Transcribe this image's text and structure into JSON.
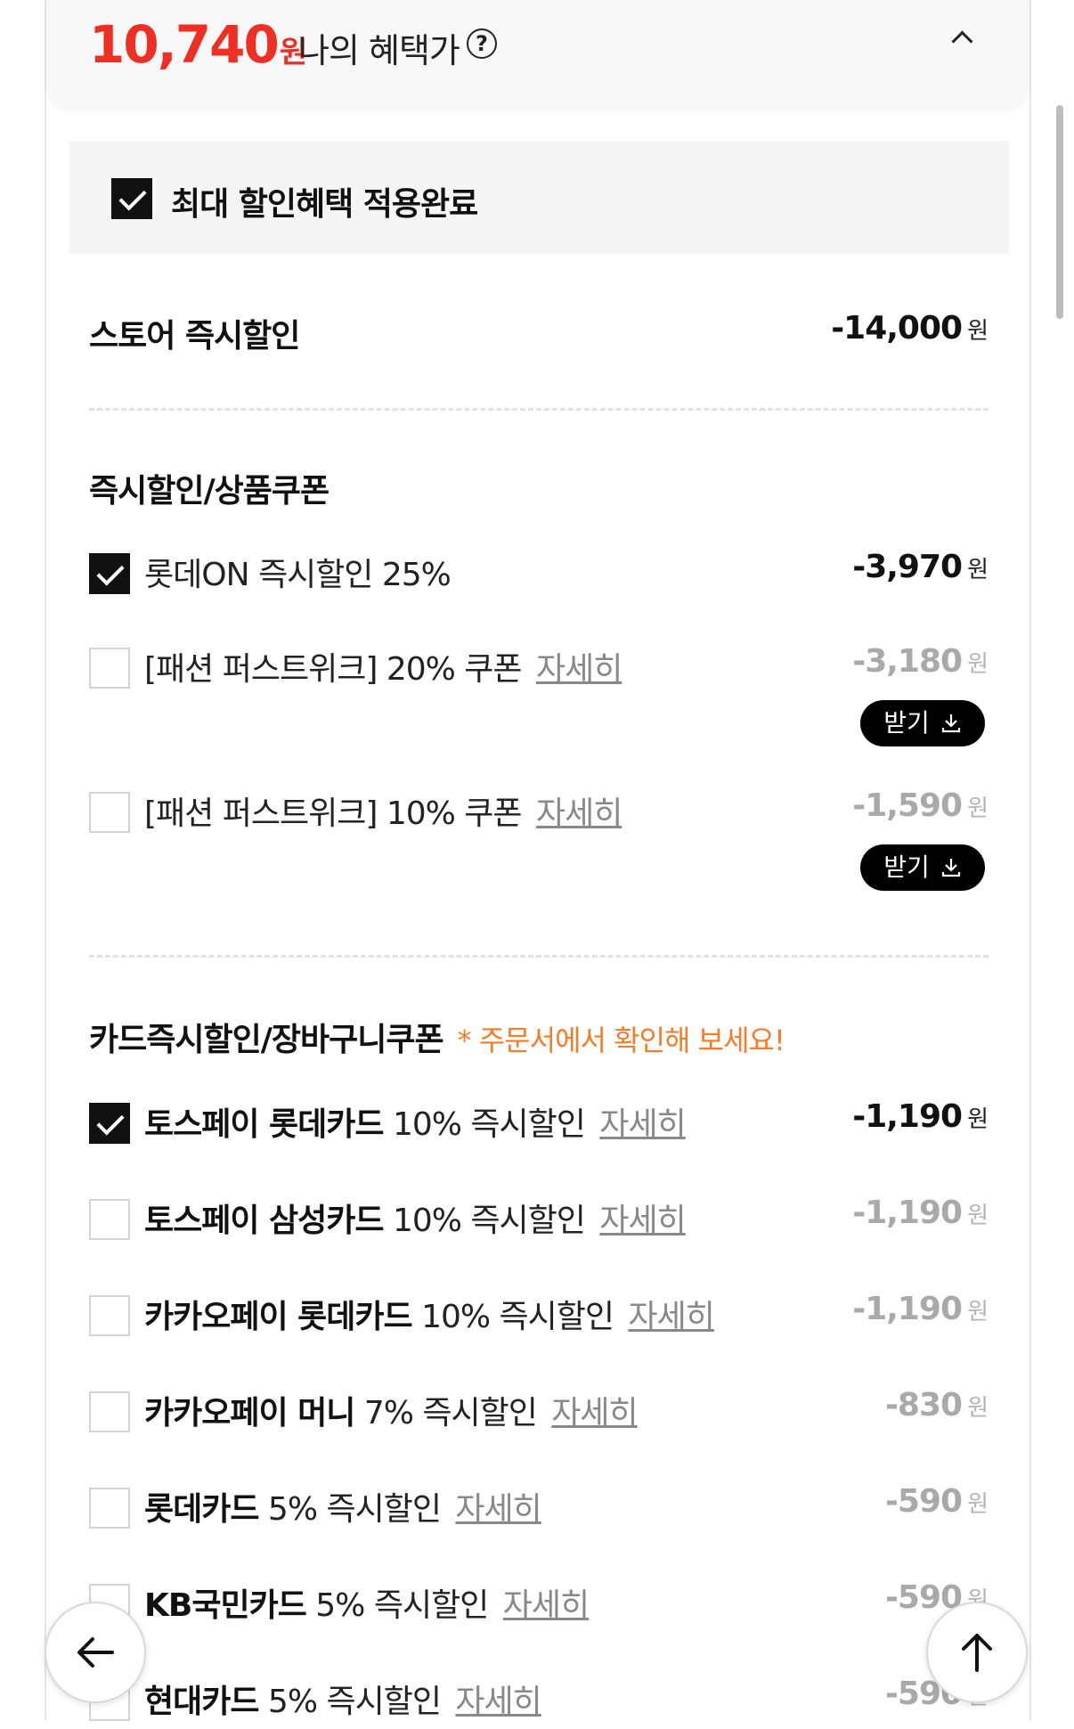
{
  "header": {
    "price": "10,740",
    "price_unit": "원",
    "benefit_label": "나의 혜택가",
    "help_icon_glyph": "?"
  },
  "applied": {
    "label": "최대 할인혜택 적용완료",
    "checked": true
  },
  "store_discount": {
    "label": "스토어 즉시할인",
    "amount": "-14,000",
    "unit": "원"
  },
  "section_instant": {
    "title": "즉시할인/상품쿠폰",
    "items": [
      {
        "label": "롯데ON 즉시할인 25%",
        "amount": "-3,970",
        "unit": "원",
        "checked": true
      },
      {
        "label": "[패션 퍼스트위크] 20% 쿠폰",
        "link": "자세히",
        "amount": "-3,180",
        "unit": "원",
        "checked": false,
        "button": "받기"
      },
      {
        "label": "[패션 퍼스트위크] 10% 쿠폰",
        "link": "자세히",
        "amount": "-1,590",
        "unit": "원",
        "checked": false,
        "button": "받기"
      }
    ]
  },
  "section_card": {
    "title": "카드즉시할인/장바구니쿠폰",
    "note": "* 주문서에서 확인해 보세요!",
    "items": [
      {
        "name": "토스페이 롯데카드",
        "desc": " 10% 즉시할인",
        "link": "자세히",
        "amount": "-1,190",
        "unit": "원",
        "checked": true
      },
      {
        "name": "토스페이 삼성카드",
        "desc": " 10% 즉시할인",
        "link": "자세히",
        "amount": "-1,190",
        "unit": "원",
        "checked": false
      },
      {
        "name": "카카오페이 롯데카드",
        "desc": " 10% 즉시할인",
        "link": "자세히",
        "amount": "-1,190",
        "unit": "원",
        "checked": false
      },
      {
        "name": "카카오페이 머니",
        "desc": " 7% 즉시할인",
        "link": "자세히",
        "amount": "-830",
        "unit": "원",
        "checked": false
      },
      {
        "name": "롯데카드",
        "desc": " 5% 즉시할인",
        "link": "자세히",
        "amount": "-590",
        "unit": "원",
        "checked": false
      },
      {
        "name": "KB국민카드",
        "desc": " 5% 즉시할인",
        "link": "자세히",
        "amount": "-590",
        "unit": "원",
        "checked": false
      },
      {
        "name": "현대카드",
        "desc": " 5% 즉시할인",
        "link": "자세히",
        "amount": "-590",
        "unit": "원",
        "checked": false
      }
    ]
  },
  "colors": {
    "price": "#ee2f24",
    "note": "#f37d2a",
    "checked": "#111111",
    "muted_amount": "#a9a9a9"
  },
  "icons": {
    "back": "arrow-left-icon",
    "top": "arrow-up-icon",
    "collapse": "chevron-up-icon",
    "download": "download-icon"
  }
}
